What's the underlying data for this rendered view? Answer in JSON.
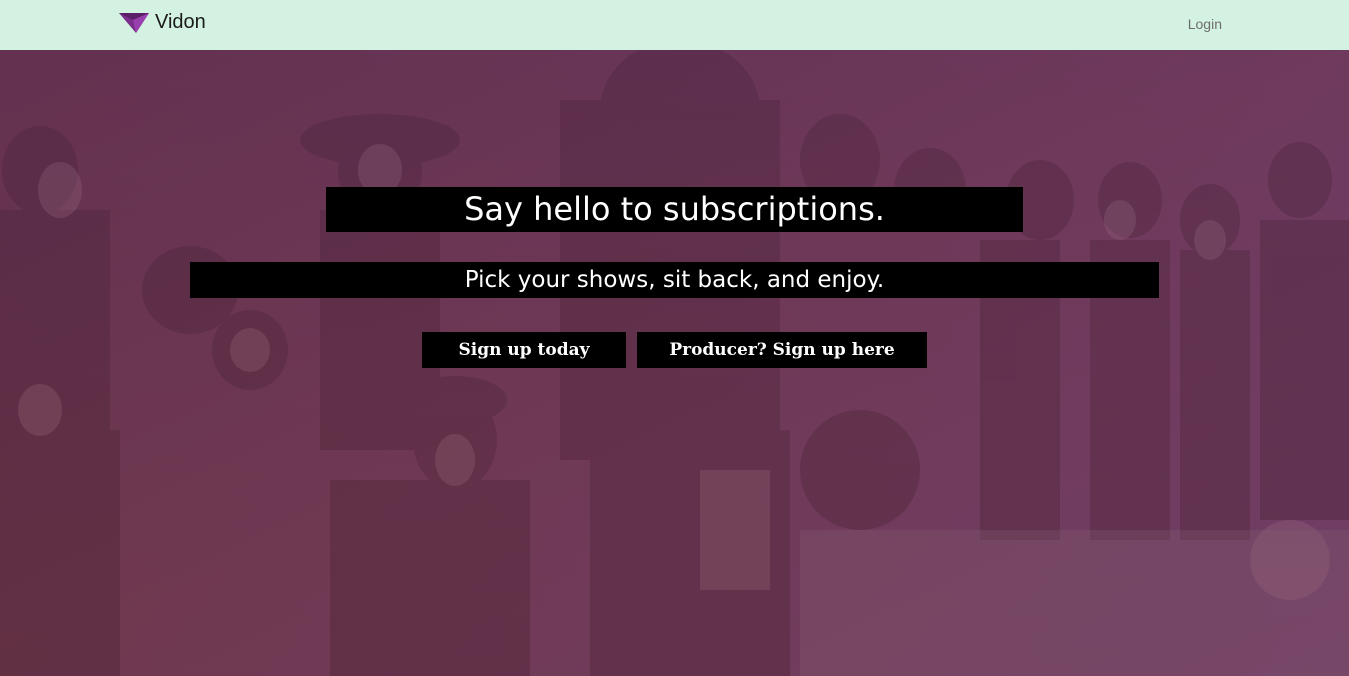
{
  "header": {
    "brand_name": "Vidon",
    "login_label": "Login",
    "colors": {
      "background": "#d3f2e1",
      "logo": "#7a2d8a"
    }
  },
  "hero": {
    "headline": "Say hello to subscriptions.",
    "subheadline": "Pick your shows, sit back, and enjoy.",
    "signup_label": "Sign up today",
    "producer_signup_label": "Producer? Sign up here",
    "colors": {
      "tint": "#6c3c5f",
      "banner": "#000000",
      "text": "#ffffff"
    }
  },
  "icons": {
    "logo": "triangle-logo-icon"
  }
}
